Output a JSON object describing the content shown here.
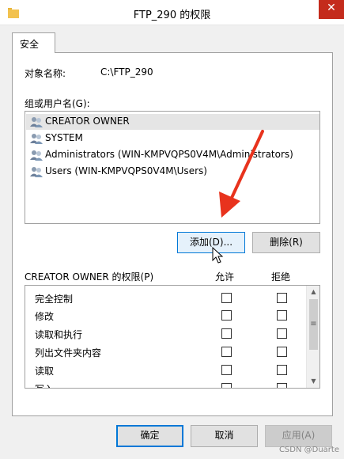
{
  "window": {
    "title": "FTP_290 的权限",
    "close_glyph": "✕"
  },
  "tabs": [
    {
      "label": "安全"
    }
  ],
  "object": {
    "label": "对象名称:",
    "value": "C:\\FTP_290"
  },
  "groups": {
    "label": "组或用户名(G):",
    "items": [
      {
        "name": "CREATOR OWNER",
        "selected": true
      },
      {
        "name": "SYSTEM",
        "selected": false
      },
      {
        "name": "Administrators (WIN-KMPVQPS0V4M\\Administrators)",
        "selected": false
      },
      {
        "name": "Users (WIN-KMPVQPS0V4M\\Users)",
        "selected": false
      }
    ]
  },
  "buttons": {
    "add": "添加(D)...",
    "remove": "删除(R)"
  },
  "permissions": {
    "label": "CREATOR OWNER 的权限(P)",
    "allow_header": "允许",
    "deny_header": "拒绝",
    "rows": [
      {
        "name": "完全控制",
        "allow": false,
        "deny": false
      },
      {
        "name": "修改",
        "allow": false,
        "deny": false
      },
      {
        "name": "读取和执行",
        "allow": false,
        "deny": false
      },
      {
        "name": "列出文件夹内容",
        "allow": false,
        "deny": false
      },
      {
        "name": "读取",
        "allow": false,
        "deny": false
      },
      {
        "name": "写入",
        "allow": false,
        "deny": false
      }
    ]
  },
  "footer": {
    "ok": "确定",
    "cancel": "取消",
    "apply": "应用(A)"
  },
  "watermark": "CSDN @Duarte",
  "colors": {
    "accent": "#0078d7",
    "close": "#c42b1c",
    "annotation_arrow": "#e8331d",
    "folder": "#e8b53a"
  },
  "icons": {
    "window": "folder-icon",
    "group": "users-icon",
    "pointer": "mouse-cursor-icon",
    "annotation": "red-arrow-icon"
  }
}
